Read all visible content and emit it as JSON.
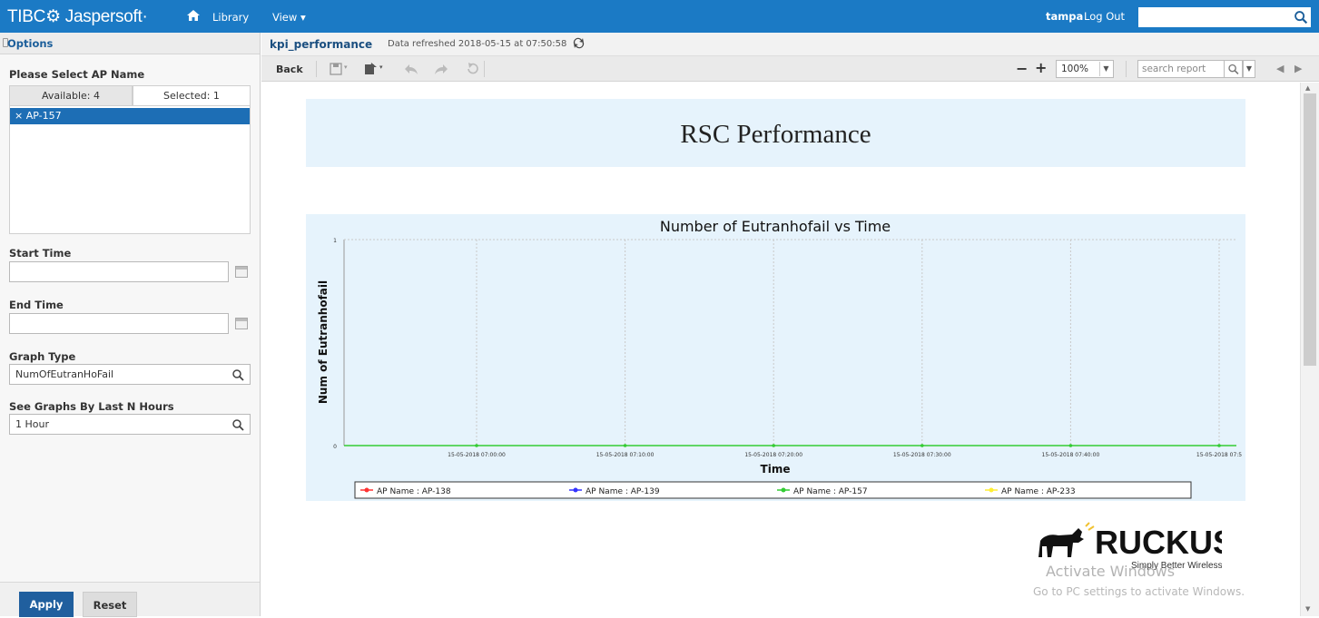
{
  "topbar": {
    "brand": "TIBC⚙ Jaspersoft·",
    "library": "Library",
    "view": "View ▾",
    "user": "tampa",
    "logout": "Log Out",
    "search_value": "",
    "accent": "#1b7ac5"
  },
  "options": {
    "title": "Options",
    "ap_label": "Please Select AP Name",
    "tab_available": "Available: 4",
    "tab_selected": "Selected: 1",
    "selected_items": [
      "× AP-157"
    ],
    "start_label": "Start Time",
    "start_value": "",
    "end_label": "End Time",
    "end_value": "",
    "graph_type_label": "Graph Type",
    "graph_type_value": "NumOfEutranHoFail",
    "last_n_label": "See Graphs By Last N Hours",
    "last_n_value": "1 Hour",
    "apply": "Apply",
    "reset": "Reset"
  },
  "report": {
    "name": "kpi_performance",
    "refreshed": "Data refreshed 2018-05-15 at 07:50:58",
    "back": "Back",
    "zoom": "100%",
    "search_placeholder": "search report",
    "title": "RSC Performance"
  },
  "chart_data": {
    "type": "line",
    "title": "Number of Eutranhofail vs Time",
    "xlabel": "Time",
    "ylabel": "Num of Eutranhofail",
    "ylim": [
      0,
      1
    ],
    "y_ticks": [
      "0",
      "1"
    ],
    "x_ticks": [
      "15-05-2018 07:00:00",
      "15-05-2018 07:10:00",
      "15-05-2018 07:20:00",
      "15-05-2018 07:30:00",
      "15-05-2018 07:40:00",
      "15-05-2018 07:5"
    ],
    "grid": true,
    "legend_position": "bottom",
    "series": [
      {
        "name": "AP Name : AP-138",
        "color": "#ff3333",
        "values": []
      },
      {
        "name": "AP Name : AP-139",
        "color": "#3333ff",
        "values": []
      },
      {
        "name": "AP Name : AP-157",
        "color": "#33cc33",
        "values": [
          0,
          0,
          0,
          0,
          0,
          0
        ]
      },
      {
        "name": "AP Name : AP-233",
        "color": "#ffee33",
        "values": []
      }
    ]
  },
  "watermark": {
    "brand": "RUCKUS",
    "tagline": "Simply Better Wireless.",
    "activate_line1": "Activate Windows",
    "activate_line2": "Go to PC settings to activate Windows."
  }
}
